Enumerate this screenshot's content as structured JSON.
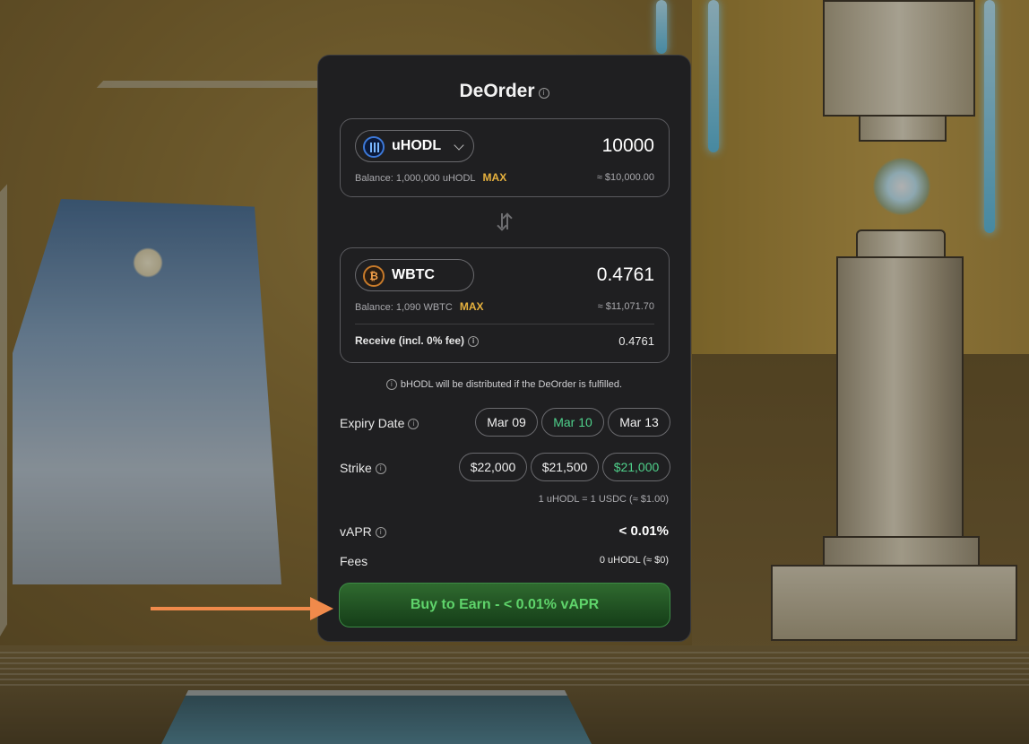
{
  "app": {
    "title": "DeOrder"
  },
  "from_token": {
    "symbol": "uHODL",
    "amount": "10000",
    "balance_text": "Balance: 1,000,000 uHODL",
    "max_label": "MAX",
    "usd_value": "≈ $10,000.00",
    "icon": "uhodl-logo-icon"
  },
  "to_token": {
    "symbol": "WBTC",
    "amount": "0.4761",
    "balance_text": "Balance: 1,090 WBTC",
    "max_label": "MAX",
    "usd_value": "≈ $11,071.70",
    "icon": "bitcoin-logo-icon",
    "receive_label": "Receive (incl. 0% fee)",
    "receive_value": "0.4761"
  },
  "notice": "bHODL will be distributed if the DeOrder is fulfilled.",
  "expiry": {
    "label": "Expiry Date",
    "options": [
      "Mar 09",
      "Mar 10",
      "Mar 13"
    ],
    "selected": "Mar 10"
  },
  "strike": {
    "label": "Strike",
    "options": [
      "$22,000",
      "$21,500",
      "$21,000"
    ],
    "selected": "$21,000"
  },
  "rate_text": "1 uHODL = 1 USDC (≈ $1.00)",
  "vapr": {
    "label": "vAPR",
    "value": "< 0.01%"
  },
  "fees": {
    "label": "Fees",
    "value": "0 uHODL (≈ $0)"
  },
  "cta_label": "Buy to Earn - < 0.01% vAPR",
  "colors": {
    "panel_bg": "#1f1f21",
    "selected_green": "#4fd18b",
    "max_gold": "#e6b13e",
    "cta_green": "#5fd46b",
    "annotation_arrow": "#f08a4b"
  }
}
